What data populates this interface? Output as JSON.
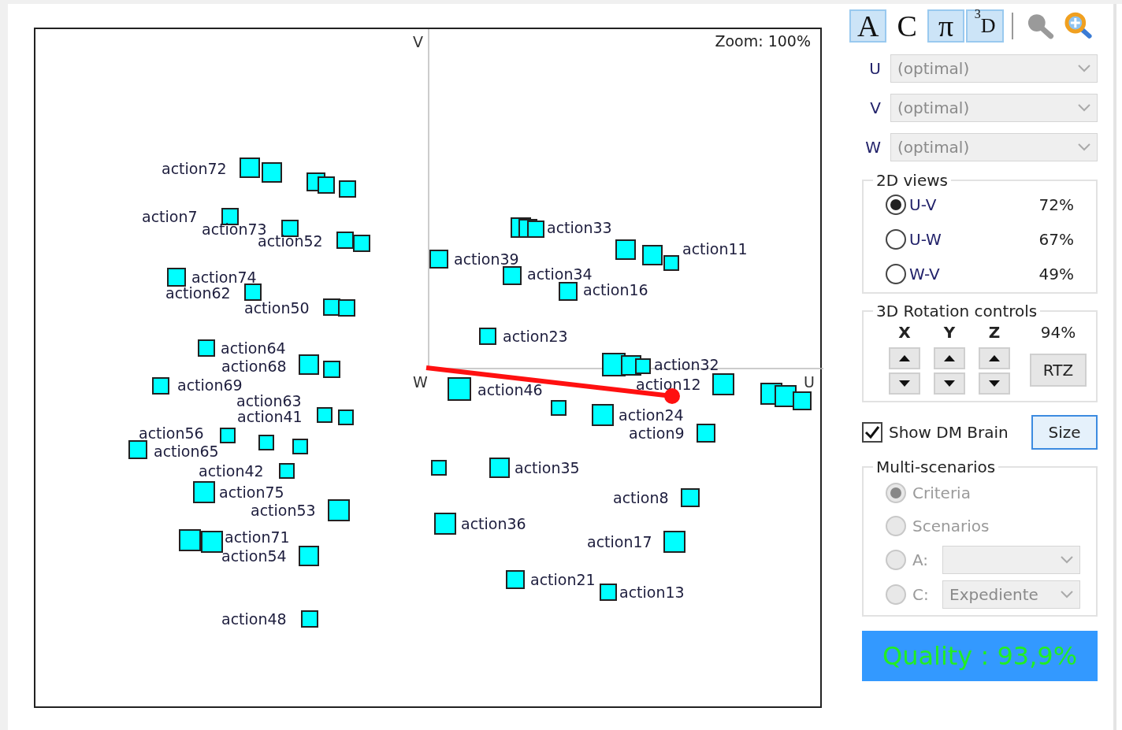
{
  "plot": {
    "axis_labels": {
      "v": "V",
      "w": "W",
      "u": "U"
    },
    "zoom": "Zoom: 100%",
    "points": [
      {
        "label": "action72"
      },
      {
        "label": "action7"
      },
      {
        "label": "action73"
      },
      {
        "label": "action52"
      },
      {
        "label": "action74"
      },
      {
        "label": "action62"
      },
      {
        "label": "action50"
      },
      {
        "label": "action64"
      },
      {
        "label": "action68"
      },
      {
        "label": "action69"
      },
      {
        "label": "action63"
      },
      {
        "label": "action41"
      },
      {
        "label": "action56"
      },
      {
        "label": "action65"
      },
      {
        "label": "action42"
      },
      {
        "label": "action75"
      },
      {
        "label": "action53"
      },
      {
        "label": "action71"
      },
      {
        "label": "action54"
      },
      {
        "label": "action48"
      },
      {
        "label": "action33"
      },
      {
        "label": "action39"
      },
      {
        "label": "action11"
      },
      {
        "label": "action34"
      },
      {
        "label": "action16"
      },
      {
        "label": "action23"
      },
      {
        "label": "action32"
      },
      {
        "label": "action12"
      },
      {
        "label": "action46"
      },
      {
        "label": "action24"
      },
      {
        "label": "action9"
      },
      {
        "label": "action35"
      },
      {
        "label": "action8"
      },
      {
        "label": "action36"
      },
      {
        "label": "action17"
      },
      {
        "label": "action21"
      },
      {
        "label": "action13"
      }
    ]
  },
  "toolbar": [
    {
      "kind": "toggle",
      "label": "A",
      "selected": true
    },
    {
      "kind": "toggle",
      "label": "C",
      "selected": false
    },
    {
      "kind": "toggle",
      "label": "π",
      "selected": true
    },
    {
      "kind": "toggle",
      "label": "$^{3}$D",
      "selected": true
    },
    {
      "kind": "separator"
    },
    {
      "kind": "search"
    },
    {
      "kind": "zoom"
    }
  ],
  "axes": [
    {
      "label": "U",
      "value": "(optimal)",
      "disabled": true
    },
    {
      "label": "V",
      "value": "(optimal)",
      "disabled": true
    },
    {
      "label": "W",
      "value": "(optimal)",
      "disabled": true
    }
  ],
  "views_2d": {
    "title": "2D views",
    "options": [
      {
        "label": "U-V",
        "percent": "72%",
        "selected": true
      },
      {
        "label": "U-W",
        "percent": "67%",
        "selected": false
      },
      {
        "label": "W-V",
        "percent": "49%",
        "selected": false
      }
    ]
  },
  "rotation": {
    "title": "3D Rotation controls",
    "axes": [
      "X",
      "Y",
      "Z"
    ],
    "percent": "94%",
    "reset": "RTZ"
  },
  "show_dm_brain": {
    "label": "Show DM Brain",
    "checked": true
  },
  "size_button": "Size",
  "multi_scenarios": {
    "title": "Multi-scenarios",
    "disabled": true,
    "options": [
      {
        "kind": "radio",
        "label": "Criteria",
        "selected": true
      },
      {
        "kind": "radio",
        "label": "Scenarios",
        "selected": false
      },
      {
        "kind": "select",
        "label": "A:",
        "selected": false
      },
      {
        "kind": "select",
        "label": "C:",
        "value": "Expediente",
        "selected": false
      }
    ]
  },
  "quality": "Quality : 93,9%"
}
